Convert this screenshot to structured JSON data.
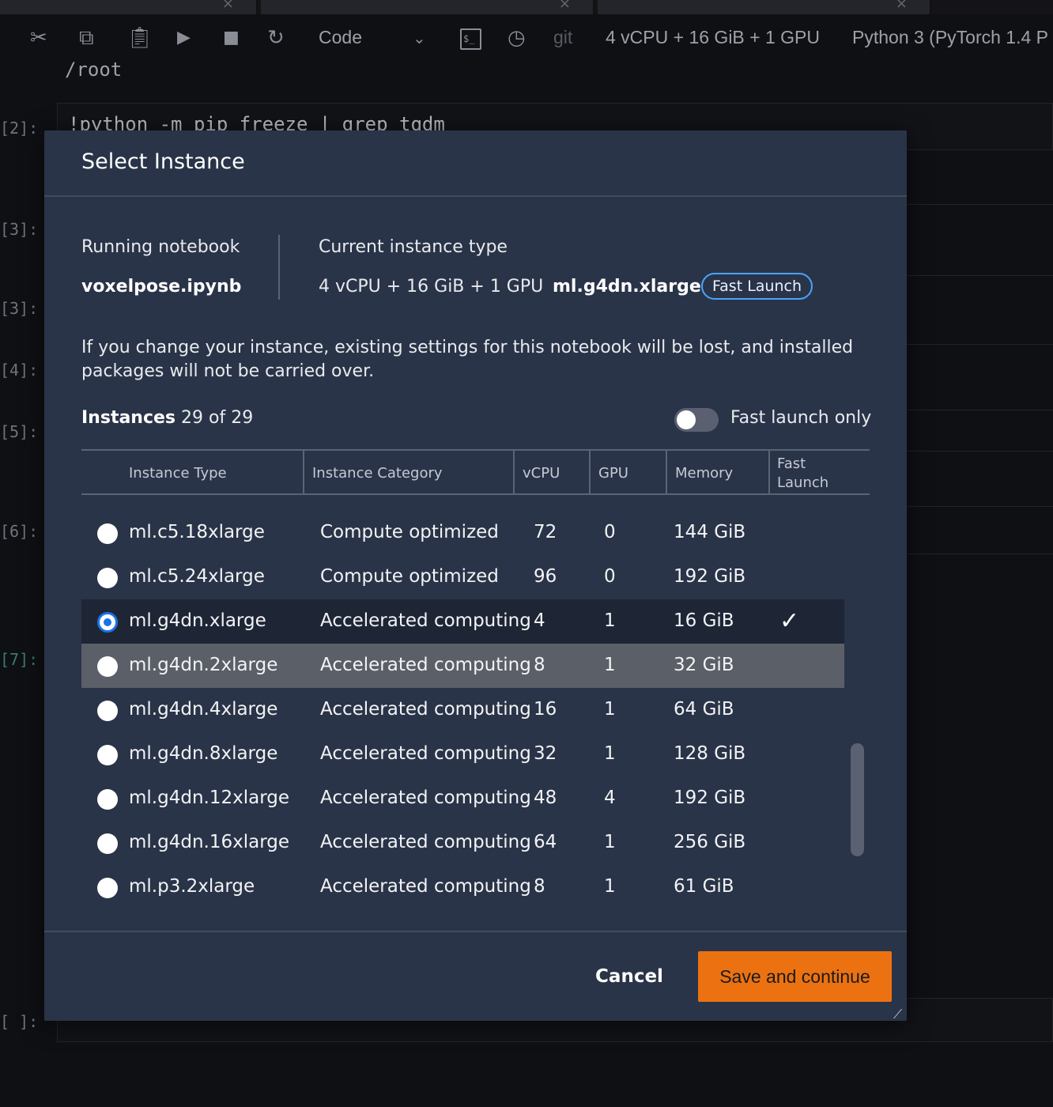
{
  "background": {
    "toolbar": {
      "kernel_dropdown": "Code",
      "git_label": "git",
      "instance_label": "4 vCPU + 16 GiB + 1 GPU",
      "kernel_name": "Python 3 (PyTorch 1.4 P"
    },
    "path": "/root",
    "cells": [
      {
        "prompt": "[2]:"
      },
      {
        "prompt": "[3]:"
      },
      {
        "prompt": "[3]:"
      },
      {
        "prompt": "[4]:"
      },
      {
        "prompt": "[5]:"
      },
      {
        "prompt": "[6]:"
      },
      {
        "prompt": "[7]:"
      },
      {
        "prompt": "[ ]:"
      }
    ],
    "code_fragment": "!python -m pip freeze | grep tqdm"
  },
  "modal": {
    "title": "Select Instance",
    "running_notebook_label": "Running notebook",
    "running_notebook_value": "voxelpose.ipynb",
    "current_instance_label": "Current instance type",
    "current_instance_spec": "4 vCPU + 16 GiB + 1 GPU",
    "current_instance_name": "ml.g4dn.xlarge",
    "current_instance_badge": "Fast Launch",
    "warning": "If you change your instance, existing settings for this notebook will be lost, and installed packages will not be carried over.",
    "instances_label": "Instances",
    "instances_count": "29 of 29",
    "fast_launch_toggle_label": "Fast launch only",
    "fast_launch_toggle_on": false,
    "columns": {
      "type": "Instance Type",
      "category": "Instance Category",
      "vcpu": "vCPU",
      "gpu": "GPU",
      "memory": "Memory",
      "fast_launch": "Fast Launch"
    },
    "rows": [
      {
        "type": "ml.c5.18xlarge",
        "category": "Compute optimized",
        "vcpu": "72",
        "gpu": "0",
        "memory": "144 GiB",
        "fast": false,
        "selected": false
      },
      {
        "type": "ml.c5.24xlarge",
        "category": "Compute optimized",
        "vcpu": "96",
        "gpu": "0",
        "memory": "192 GiB",
        "fast": false,
        "selected": false
      },
      {
        "type": "ml.g4dn.xlarge",
        "category": "Accelerated computing",
        "vcpu": "4",
        "gpu": "1",
        "memory": "16 GiB",
        "fast": true,
        "selected": true
      },
      {
        "type": "ml.g4dn.2xlarge",
        "category": "Accelerated computing",
        "vcpu": "8",
        "gpu": "1",
        "memory": "32 GiB",
        "fast": false,
        "selected": false,
        "hover": true
      },
      {
        "type": "ml.g4dn.4xlarge",
        "category": "Accelerated computing",
        "vcpu": "16",
        "gpu": "1",
        "memory": "64 GiB",
        "fast": false,
        "selected": false
      },
      {
        "type": "ml.g4dn.8xlarge",
        "category": "Accelerated computing",
        "vcpu": "32",
        "gpu": "1",
        "memory": "128 GiB",
        "fast": false,
        "selected": false
      },
      {
        "type": "ml.g4dn.12xlarge",
        "category": "Accelerated computing",
        "vcpu": "48",
        "gpu": "4",
        "memory": "192 GiB",
        "fast": false,
        "selected": false
      },
      {
        "type": "ml.g4dn.16xlarge",
        "category": "Accelerated computing",
        "vcpu": "64",
        "gpu": "1",
        "memory": "256 GiB",
        "fast": false,
        "selected": false
      },
      {
        "type": "ml.p3.2xlarge",
        "category": "Accelerated computing",
        "vcpu": "8",
        "gpu": "1",
        "memory": "61 GiB",
        "fast": false,
        "selected": false
      }
    ],
    "cancel_label": "Cancel",
    "save_label": "Save and continue",
    "colors": {
      "modal_bg": "#2a3448",
      "selected_row": "#1e2636",
      "hover_row": "#5b5f68",
      "primary_button": "#ec7211",
      "badge_border": "#4aa3ff",
      "radio_checked": "#1a73e8"
    }
  }
}
